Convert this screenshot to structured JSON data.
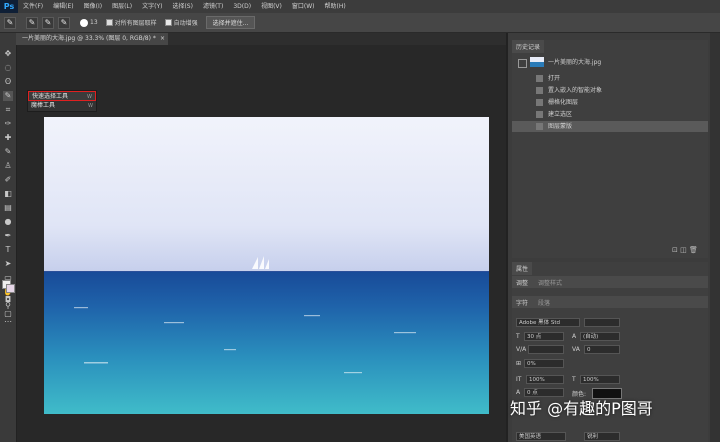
{
  "app": {
    "logo": "Ps"
  },
  "menu": [
    "文件(F)",
    "编辑(E)",
    "图像(I)",
    "图层(L)",
    "文字(Y)",
    "选择(S)",
    "滤镜(T)",
    "3D(D)",
    "视图(V)",
    "窗口(W)",
    "帮助(H)"
  ],
  "options": {
    "brush_size": "13",
    "sample_all_label": "对所有图层取样",
    "auto_enhance_label": "自动增强",
    "refine_button": "选择并遮住..."
  },
  "document": {
    "tab_title": "一片美丽的大海.jpg @ 33.3% (图层 0, RGB/8) *",
    "tab_close": "×"
  },
  "flyout": {
    "quick_select": "快速选择工具",
    "quick_select_key": "W",
    "magic_wand": "魔棒工具",
    "magic_wand_key": "W"
  },
  "history": {
    "tab": "历史记录",
    "snapshot": "一片美丽的大海.jpg",
    "items": [
      "打开",
      "置入嵌入的智能对象",
      "栅格化图层",
      "建立选区",
      "图层蒙版"
    ]
  },
  "character": {
    "tabs": [
      "属性",
      "字符"
    ],
    "panel_rows": [
      "调整",
      "字符",
      "段落"
    ],
    "panel_sublabels": [
      "调整样式",
      "段落"
    ],
    "font_family": "Adobe 黑体 Std",
    "font_style": "",
    "font_size": "30 点",
    "leading": "(自动)",
    "kerning": "",
    "tracking": "0",
    "scale_pct": "0%",
    "vert_scale": "100%",
    "horiz_scale": "100%",
    "baseline": "0 点",
    "color_label": "颜色:",
    "lang": "美国英语",
    "aa": "锐利"
  },
  "watermark": "知乎 @有趣的P图哥",
  "colors": {
    "sky_top": "#eef1fb",
    "sky_bottom": "#c9d3ee",
    "sea_deep": "#1b4f9c",
    "sea_light": "#3fb7c7"
  }
}
